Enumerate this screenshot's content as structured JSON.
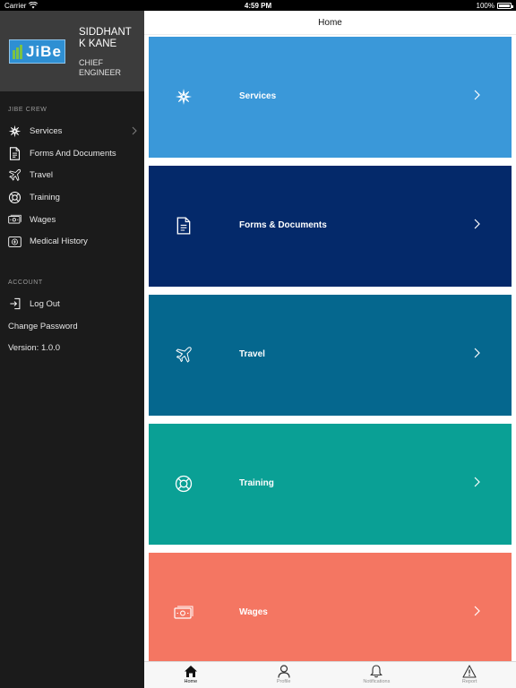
{
  "status_bar": {
    "carrier": "Carrier",
    "time": "4:59 PM",
    "battery": "100%"
  },
  "sidebar": {
    "logo_text": "JiBe",
    "profile": {
      "name": "SIDDHANT K KANE",
      "role": "CHIEF ENGINEER"
    },
    "crew_header": "JIBE CREW",
    "items": [
      {
        "label": "Services",
        "icon": "compass-icon"
      },
      {
        "label": "Forms And Documents",
        "icon": "document-icon"
      },
      {
        "label": "Travel",
        "icon": "airplane-icon"
      },
      {
        "label": "Training",
        "icon": "lifebuoy-icon"
      },
      {
        "label": "Wages",
        "icon": "banknote-icon"
      },
      {
        "label": "Medical History",
        "icon": "medical-record-icon"
      }
    ],
    "account_header": "ACCOUNT",
    "account_items": [
      {
        "label": "Log Out",
        "icon": "logout-icon"
      },
      {
        "label": "Change Password"
      },
      {
        "label": "Version: 1.0.0"
      }
    ]
  },
  "main": {
    "title": "Home",
    "cards": [
      {
        "label": "Services",
        "color": "#3a98d9",
        "icon": "compass-icon"
      },
      {
        "label": "Forms & Documents",
        "color": "#04296a",
        "icon": "document-icon"
      },
      {
        "label": "Travel",
        "color": "#05678e",
        "icon": "airplane-icon"
      },
      {
        "label": "Training",
        "color": "#0aa095",
        "icon": "lifebuoy-icon"
      },
      {
        "label": "Wages",
        "color": "#f47662",
        "icon": "banknote-icon"
      }
    ]
  },
  "tab_bar": {
    "tabs": [
      {
        "label": "Home",
        "icon": "home-icon",
        "active": true
      },
      {
        "label": "Profile",
        "icon": "person-icon",
        "active": false
      },
      {
        "label": "Notifications",
        "icon": "bell-icon",
        "active": false
      },
      {
        "label": "Report",
        "icon": "warning-icon",
        "active": false
      }
    ]
  }
}
